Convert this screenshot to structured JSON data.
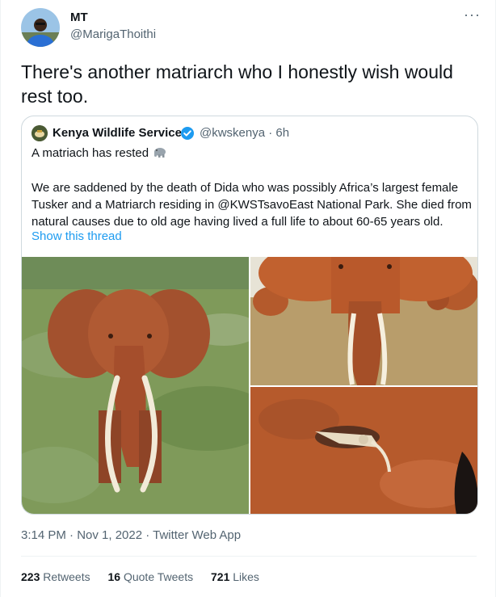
{
  "tweet": {
    "author": {
      "name": "MT",
      "handle": "@MarigaThoithi"
    },
    "more_icon": "more-horizontal-icon",
    "text": "There's another matriarch who I honestly wish would rest too.",
    "quote": {
      "name": "Kenya Wildlife Service",
      "verified_icon": "verified-badge-icon",
      "handle_time": "@kwskenya · 6h",
      "line1": "A matriach has rested",
      "emoji_icon": "elephant-emoji",
      "body": "We are saddened by the death of Dida who was possibly Africa’s largest female Tusker and a Matriarch residing in @KWSTsavoEast National Park. She died from natural causes due to old age having lived a full life to about 60-65 years old.",
      "show_thread": "Show this thread"
    },
    "meta": {
      "time_date": "3:14 PM · Nov 1, 2022 · ",
      "app": "Twitter Web App"
    },
    "stats": {
      "retweets_count": "223",
      "retweets_label": "Retweets",
      "quotes_count": "16",
      "quotes_label": "Quote Tweets",
      "likes_count": "721",
      "likes_label": "Likes"
    }
  },
  "colors": {
    "link": "#1d9bf0",
    "secondary_text": "#536471",
    "border": "#cfd9de",
    "soil": "#b65a2c"
  }
}
